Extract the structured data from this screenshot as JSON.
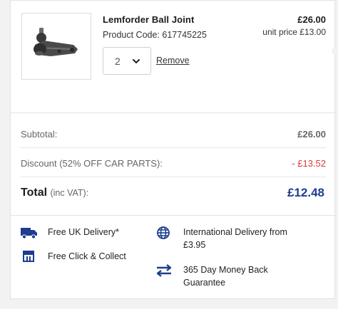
{
  "product": {
    "name": "Lemforder Ball Joint",
    "code_label": "Product Code: 617745225",
    "price": "£26.00",
    "unit_price": "unit price £13.00",
    "quantity": "2",
    "remove_label": "Remove"
  },
  "summary": {
    "subtotal_label": "Subtotal:",
    "subtotal_value": "£26.00",
    "discount_label": "Discount (52% OFF CAR PARTS):",
    "discount_value": "- £13.52",
    "total_label": "Total",
    "total_sub": "(inc VAT):",
    "total_value": "£12.48"
  },
  "features": {
    "uk_delivery": "Free UK Delivery*",
    "click_collect": "Free Click & Collect",
    "international_line1": "International Delivery from",
    "international_line2": "£3.95",
    "returns_line1": "365 Day Money Back",
    "returns_line2": "Guarantee"
  },
  "colors": {
    "accent": "#1d3d8f",
    "discount": "#d93a3a"
  },
  "icons": {
    "uk_delivery": "truck-icon",
    "click_collect": "store-icon",
    "international": "globe-icon",
    "returns": "exchange-arrows-icon",
    "quantity": "chevron-down-icon"
  }
}
